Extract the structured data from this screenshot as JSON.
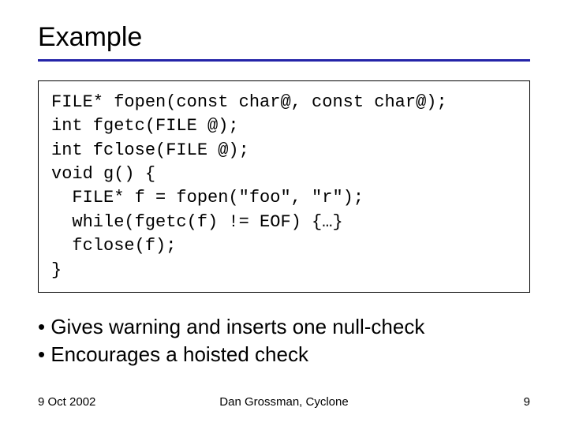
{
  "title": "Example",
  "code": {
    "lines": [
      "FILE* fopen(const char@, const char@);",
      "int fgetc(FILE @);",
      "int fclose(FILE @);",
      "void g() {",
      "  FILE* f = fopen(\"foo\", \"r\");",
      "  while(fgetc(f) != EOF) {…}",
      "  fclose(f);",
      "}"
    ]
  },
  "bullets": [
    "Gives warning and inserts one null-check",
    "Encourages a hoisted check"
  ],
  "footer": {
    "date": "9 Oct 2002",
    "author": "Dan Grossman, Cyclone",
    "page": "9"
  }
}
